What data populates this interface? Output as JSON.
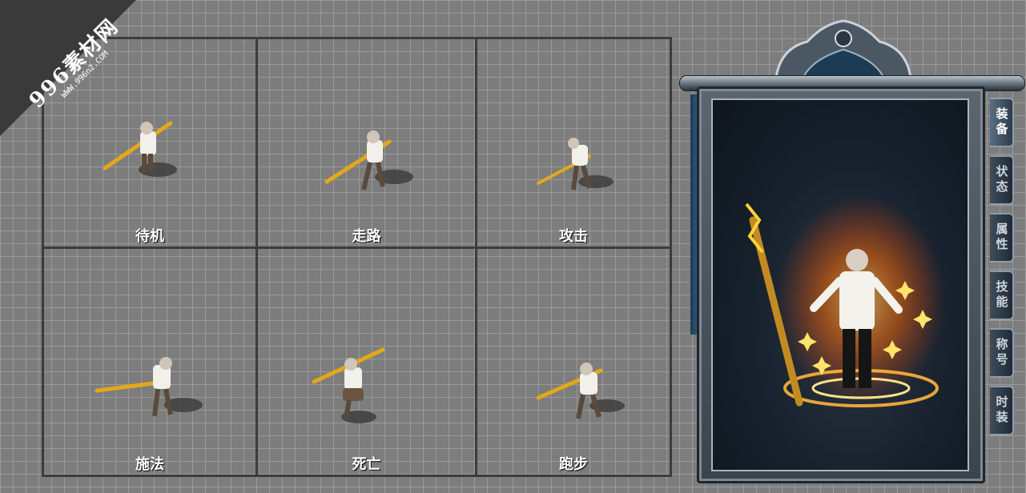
{
  "watermark": {
    "brand": "996素材网",
    "url": "WWW.996n2.COM"
  },
  "animations": [
    {
      "label": "待机"
    },
    {
      "label": "走路"
    },
    {
      "label": "攻击"
    },
    {
      "label": "施法"
    },
    {
      "label": "死亡"
    },
    {
      "label": "跑步"
    }
  ],
  "panel": {
    "tabs": [
      {
        "label": "装备",
        "active": true
      },
      {
        "label": "状态",
        "active": false
      },
      {
        "label": "属性",
        "active": false
      },
      {
        "label": "技能",
        "active": false
      },
      {
        "label": "称号",
        "active": false
      },
      {
        "label": "时装",
        "active": false
      }
    ]
  },
  "colors": {
    "grid_bg": "#7d7d7d",
    "grid_line": "#9a9a9a",
    "border": "#3c3c3c",
    "staff_gold": "#e2a81a",
    "fire": "#ff6a00"
  }
}
